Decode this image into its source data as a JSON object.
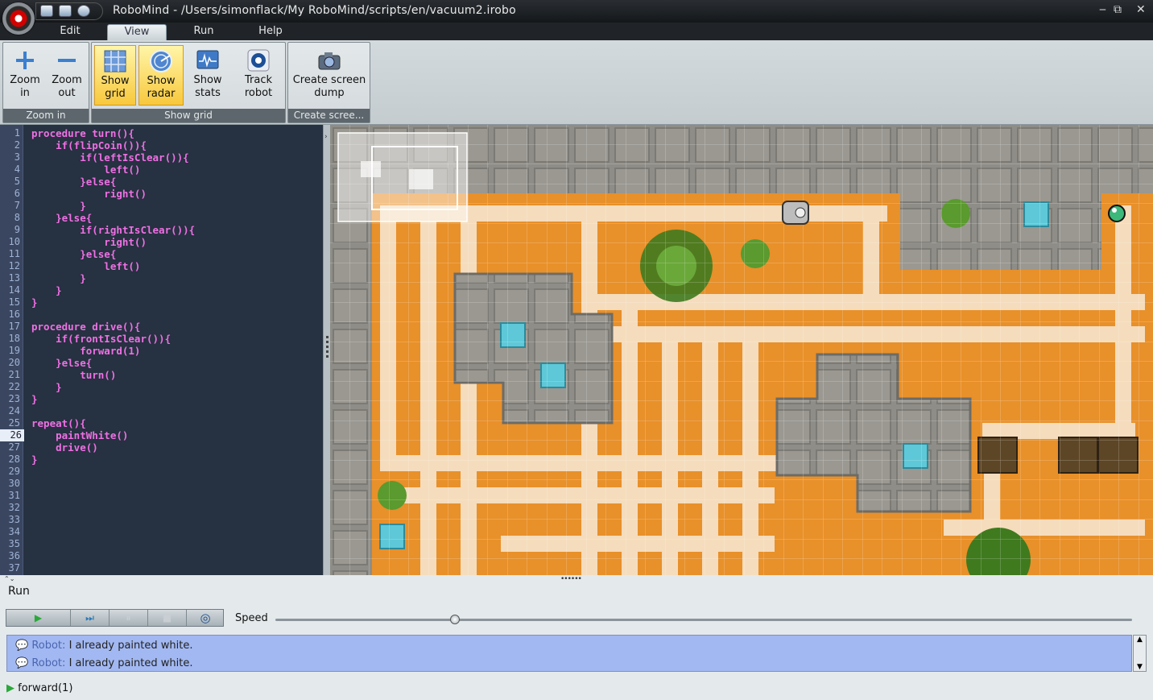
{
  "window": {
    "title": "RoboMind - /Users/simonflack/My RoboMind/scripts/en/vacuum2.irobo",
    "minimize": "‒",
    "restore": "⧉",
    "close": "✕"
  },
  "menu": [
    {
      "label": "Edit",
      "active": false
    },
    {
      "label": "View",
      "active": true
    },
    {
      "label": "Run",
      "active": false
    },
    {
      "label": "Help",
      "active": false
    }
  ],
  "ribbon": {
    "zoom_in_l1": "Zoom",
    "zoom_in_l2": "in",
    "zoom_out_l1": "Zoom",
    "zoom_out_l2": "out",
    "zoom_group": "Zoom in",
    "show_grid_l1": "Show",
    "show_grid_l2": "grid",
    "show_radar_l1": "Show",
    "show_radar_l2": "radar",
    "show_stats_l1": "Show",
    "show_stats_l2": "stats",
    "track_robot_l1": "Track",
    "track_robot_l2": "robot",
    "view_group": "Show grid",
    "dump_l1": "Create screen",
    "dump_l2": "dump",
    "dump_group": "Create scree..."
  },
  "editor": {
    "current_line": 26,
    "line_numbers": [
      "1",
      "2",
      "3",
      "4",
      "5",
      "6",
      "7",
      "8",
      "9",
      "10",
      "11",
      "12",
      "13",
      "14",
      "15",
      "16",
      "17",
      "18",
      "19",
      "20",
      "21",
      "22",
      "23",
      "24",
      "25",
      "26",
      "27",
      "28",
      "29",
      "30",
      "31",
      "32",
      "33",
      "34",
      "35",
      "36",
      "37"
    ],
    "lines": [
      "procedure turn(){",
      "    if(flipCoin()){",
      "        if(leftIsClear()){",
      "            left()",
      "        }else{",
      "            right()",
      "        }",
      "    }else{",
      "        if(rightIsClear()){",
      "            right()",
      "        }else{",
      "            left()",
      "        }",
      "    }",
      "}",
      "",
      "procedure drive(){",
      "    if(frontIsClear()){",
      "        forward(1)",
      "    }else{",
      "        turn()",
      "    }",
      "}",
      "",
      "repeat(){",
      "    paintWhite()",
      "    drive()",
      "}"
    ]
  },
  "run_panel": {
    "title": "Run",
    "play": "▶",
    "step": "⏭",
    "pause": "⏸",
    "stop": "■",
    "radar": "◎",
    "speed_label": "Speed",
    "speed_value": 0.21,
    "messages": [
      {
        "who": "Robot:",
        "text": "I already painted white."
      },
      {
        "who": "Robot:",
        "text": "I already painted white."
      }
    ],
    "status": "forward(1)"
  },
  "colors": {
    "accent": "#f8c83c",
    "sand": "#e8902a",
    "path": "#f5dcbc",
    "stone": "#8e8d88",
    "editor_bg": "#263141",
    "keyword": "#ef70e4"
  }
}
